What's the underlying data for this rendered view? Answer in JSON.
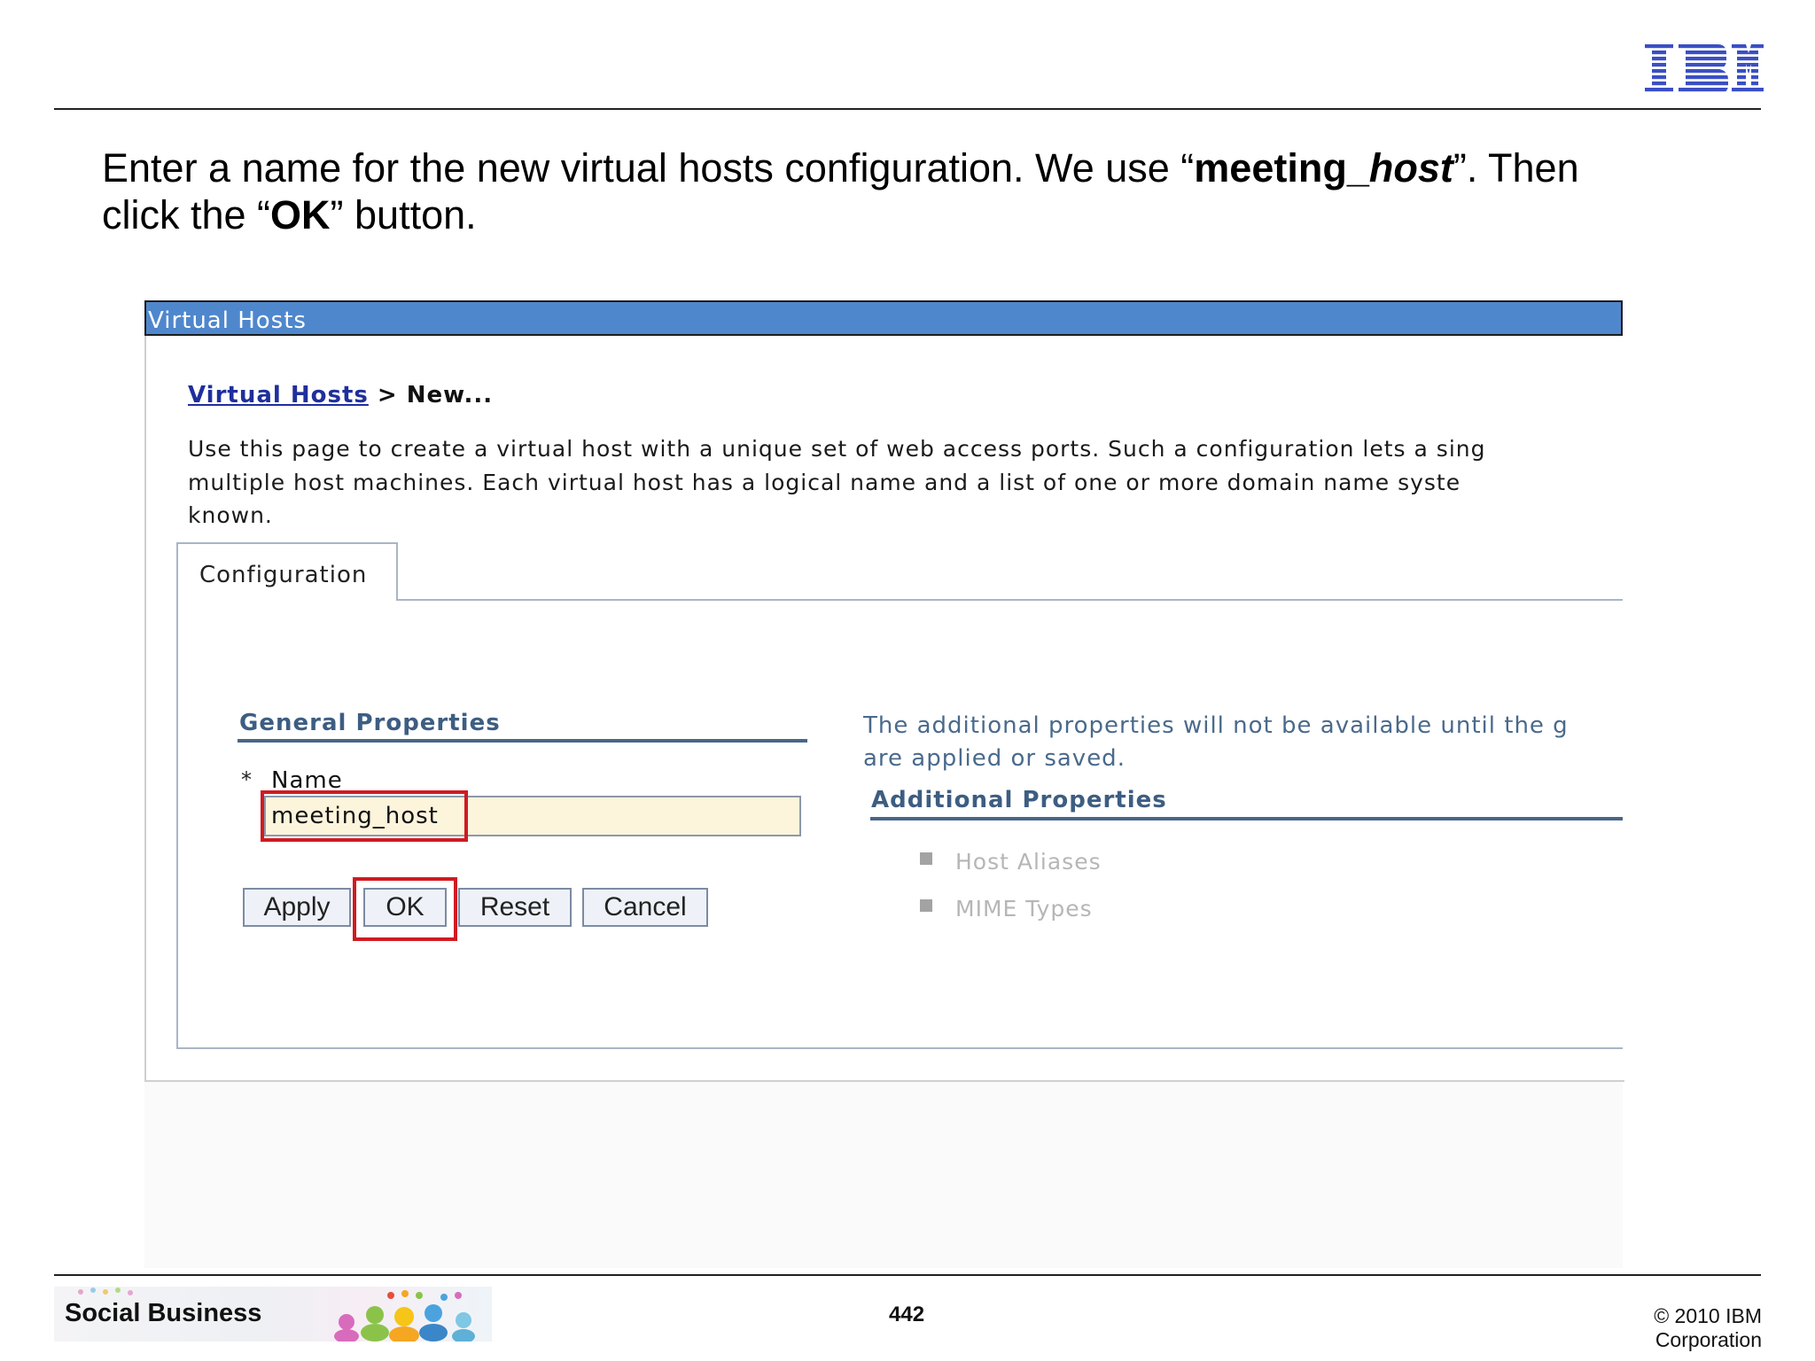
{
  "slide": {
    "instruction": {
      "line1_pre": "Enter a name for the new virtual hosts configuration. We use “",
      "bold1": "meeting_",
      "bold_italic1": "host",
      "line1_post": "”. Then",
      "line2_pre": "click the “",
      "bold2": "OK",
      "line2_post": "” button."
    },
    "logo_text": "IBM",
    "footer": {
      "banner_label": "Social Business",
      "page_number": "442",
      "copyright": "© 2010 IBM Corporation"
    }
  },
  "console": {
    "title": "Virtual Hosts",
    "breadcrumb": {
      "link": "Virtual Hosts",
      "separator": " > ",
      "current": "New..."
    },
    "description_lines": [
      "Use this page to create a virtual host with a unique set of web access ports. Such a configuration lets a sing",
      "multiple host machines. Each virtual host has a logical name and a list of one or more domain name syste",
      "known."
    ],
    "tab": "Configuration",
    "general_properties": {
      "heading": "General Properties",
      "required_marker": "*",
      "name_label": "Name",
      "name_value": "meeting_host"
    },
    "buttons": {
      "apply": "Apply",
      "ok": "OK",
      "reset": "Reset",
      "cancel": "Cancel"
    },
    "additional_properties": {
      "note_lines": [
        "The additional properties will not be available until the g",
        "are applied or saved."
      ],
      "heading": "Additional Properties",
      "items": [
        "Host Aliases",
        "MIME Types"
      ]
    },
    "highlight_color": "#d01a22",
    "title_bar_color": "#4f87cd"
  }
}
